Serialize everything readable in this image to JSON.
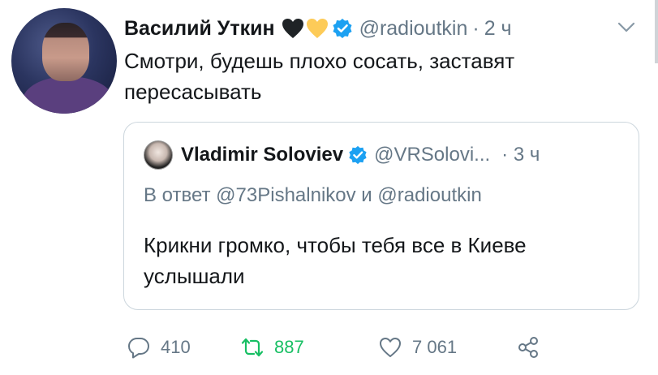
{
  "tweet": {
    "author_name": "Василий Уткин",
    "handle": "@radioutkin",
    "separator": "·",
    "time": "2 ч",
    "text": "Смотри, будешь плохо сосать, заставят пересасывать",
    "emoji": [
      "black-heart",
      "yellow-heart"
    ],
    "verified": true
  },
  "quote": {
    "author_name": "Vladimir Soloviev",
    "handle": "@VRSolovi...",
    "separator": "·",
    "time": "3 ч",
    "reply_to": "В ответ @73Pishalnikov и @radioutkin",
    "text": "Крикни громко, чтобы тебя все в Киеве услышали",
    "verified": true
  },
  "actions": {
    "replies": "410",
    "retweets": "887",
    "likes": "7 061"
  },
  "colors": {
    "text": "#14171a",
    "secondary": "#657786",
    "verified_blue": "#1da1f2",
    "retweet_green": "#17bf63",
    "border": "#ccd6dd"
  }
}
